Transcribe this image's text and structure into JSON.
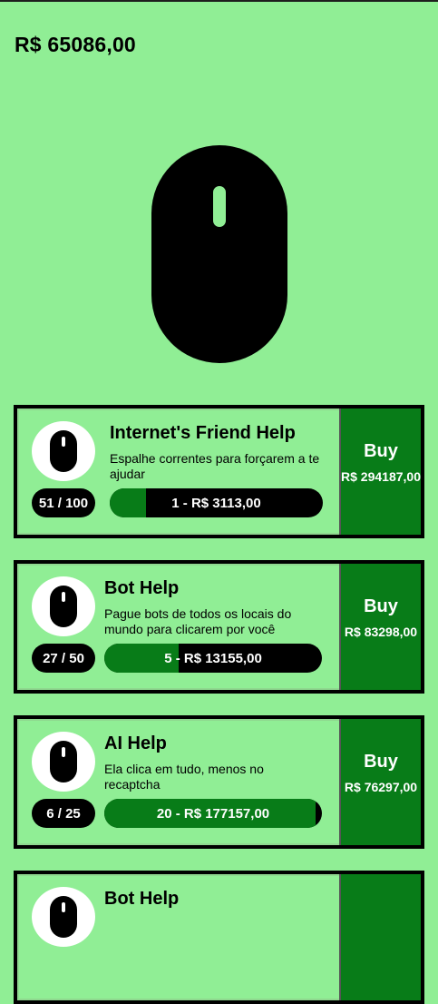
{
  "balance": "R$ 65086,00",
  "colors": {
    "background": "#90ee95",
    "accent_green": "#087c18",
    "dark": "#000000"
  },
  "upgrades": [
    {
      "title": "Internet's Friend Help",
      "description": "Espalhe correntes para forçarem a te ajudar",
      "count": "51 / 100",
      "progress_fraction": 0.17,
      "progress_label": "1 - R$ 3113,00",
      "buy_label": "Buy",
      "price": "R$ 294187,00",
      "icon": "mouse-icon"
    },
    {
      "title": "Bot Help",
      "description": "Pague bots de todos os locais do mundo para clicarem por você",
      "count": "27 / 50",
      "progress_fraction": 0.34,
      "progress_label": "5 - R$ 13155,00",
      "buy_label": "Buy",
      "price": "R$ 83298,00",
      "icon": "mouse-icon"
    },
    {
      "title": "AI Help",
      "description": "Ela clica em tudo, menos no recaptcha",
      "count": "6 / 25",
      "progress_fraction": 0.97,
      "progress_label": "20 - R$ 177157,00",
      "buy_label": "Buy",
      "price": "R$ 76297,00",
      "icon": "mouse-icon"
    },
    {
      "title": "Bot Help",
      "icon": "mouse-icon"
    }
  ]
}
